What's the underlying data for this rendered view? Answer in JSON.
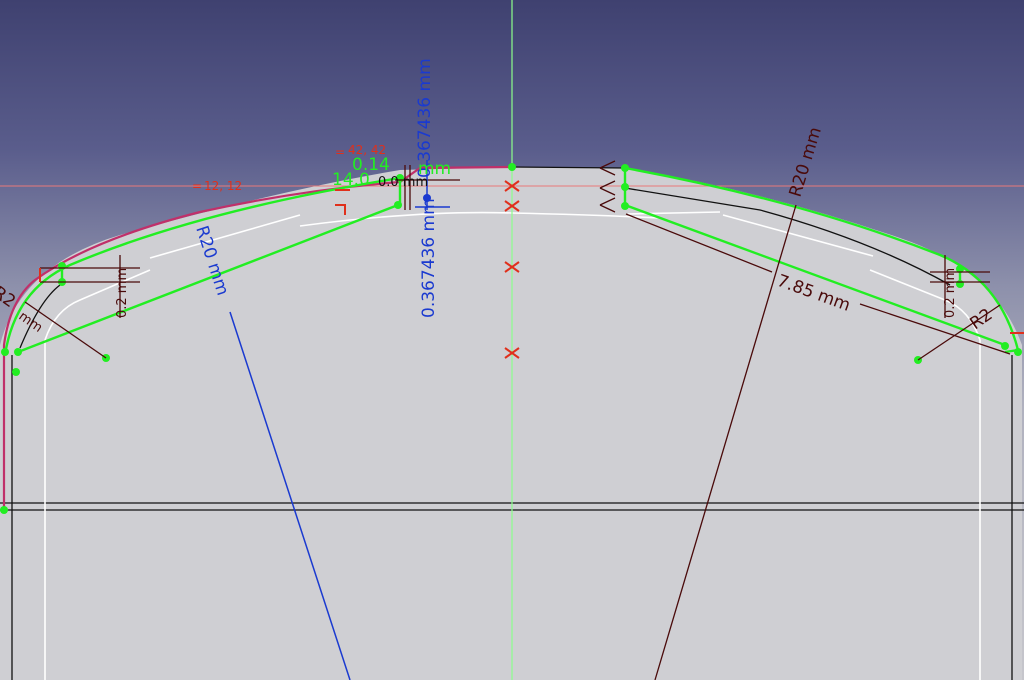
{
  "viewer": {
    "colors": {
      "background_top": "#3f4170",
      "background_bottom": "#c6c6cc",
      "body_fill": "#cfcfd3",
      "edge": "#111111",
      "construction": "#ffffff",
      "selected": "#22ee22",
      "preselected": "#c0306a",
      "dimension": "#4a0a0a",
      "driving_dimension_active": "#1a3ad0",
      "constraint": "#e0301c",
      "axis_vertical": "#8cff8c",
      "axis_horizontal": "#e87a7a"
    }
  },
  "dimensions": {
    "radius_left": "R20 mm",
    "radius_right": "R20 mm",
    "vertical_blue_top": "0.367436 mm",
    "vertical_blue_bottom": "0.367436 mm",
    "length_right": "7.85 mm",
    "width_left": "0.2 mm",
    "width_right": "0.2 mm",
    "corner_left": "R2",
    "corner_left_unit": "mm",
    "corner_right": "R2",
    "green_a": "0.14",
    "green_b": "14.0",
    "green_c": "mm",
    "black_overlap": "0.0 mm"
  },
  "constraints": {
    "equal_top": "42, 42",
    "equal_left": "12, 12",
    "equal_top_symbol": "=",
    "equal_left_symbol": "="
  }
}
